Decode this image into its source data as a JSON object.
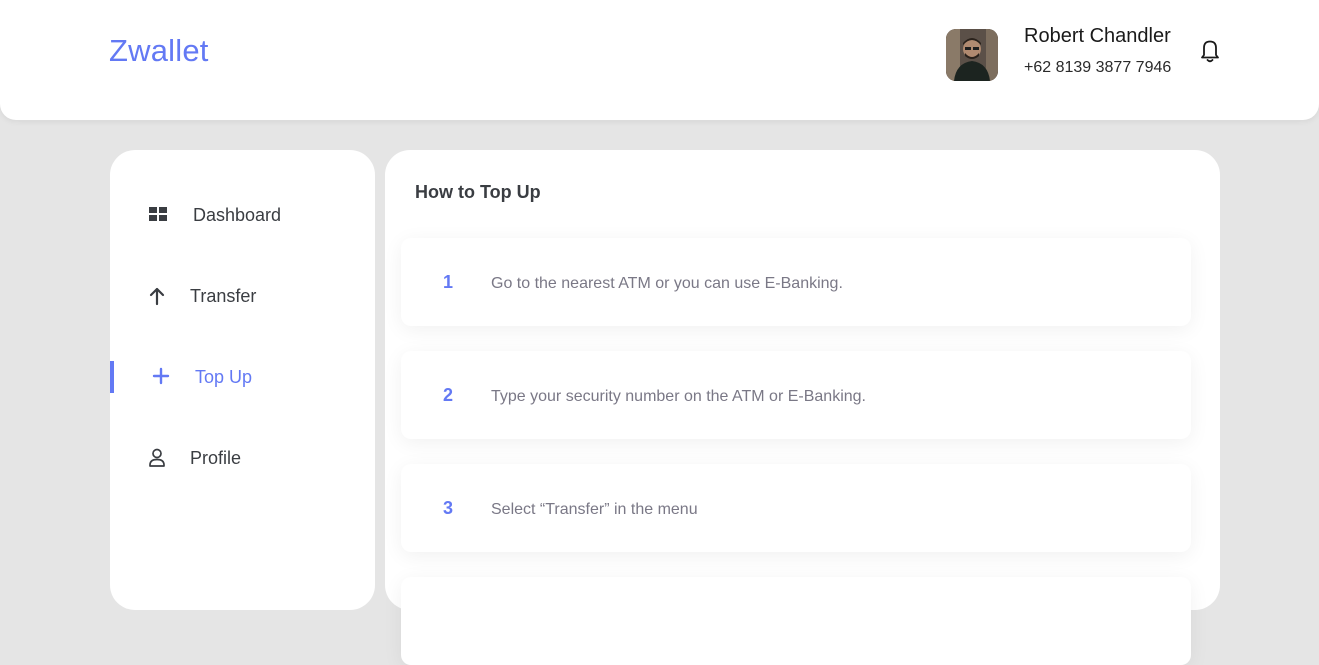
{
  "header": {
    "brand": "Zwallet",
    "user": {
      "name": "Robert Chandler",
      "phone": "+62 8139 3877 7946",
      "avatar_icon": "user-avatar-photo"
    },
    "notification_icon": "bell-icon"
  },
  "sidebar": {
    "items": [
      {
        "label": "Dashboard",
        "icon": "grid-icon",
        "active": false
      },
      {
        "label": "Transfer",
        "icon": "arrow-up-icon",
        "active": false
      },
      {
        "label": "Top Up",
        "icon": "plus-icon",
        "active": true
      },
      {
        "label": "Profile",
        "icon": "user-icon",
        "active": false
      }
    ]
  },
  "main": {
    "title": "How to Top Up",
    "steps": [
      {
        "number": "1",
        "text": "Go to the nearest ATM or you can use E-Banking."
      },
      {
        "number": "2",
        "text": "Type your security number on the ATM or E-Banking."
      },
      {
        "number": "3",
        "text": "Select “Transfer” in the menu"
      }
    ]
  },
  "colors": {
    "accent": "#6379f4",
    "background": "#e5e5e5",
    "card": "#ffffff",
    "text_muted": "#7a7886",
    "text_dark": "#3a3d42"
  }
}
